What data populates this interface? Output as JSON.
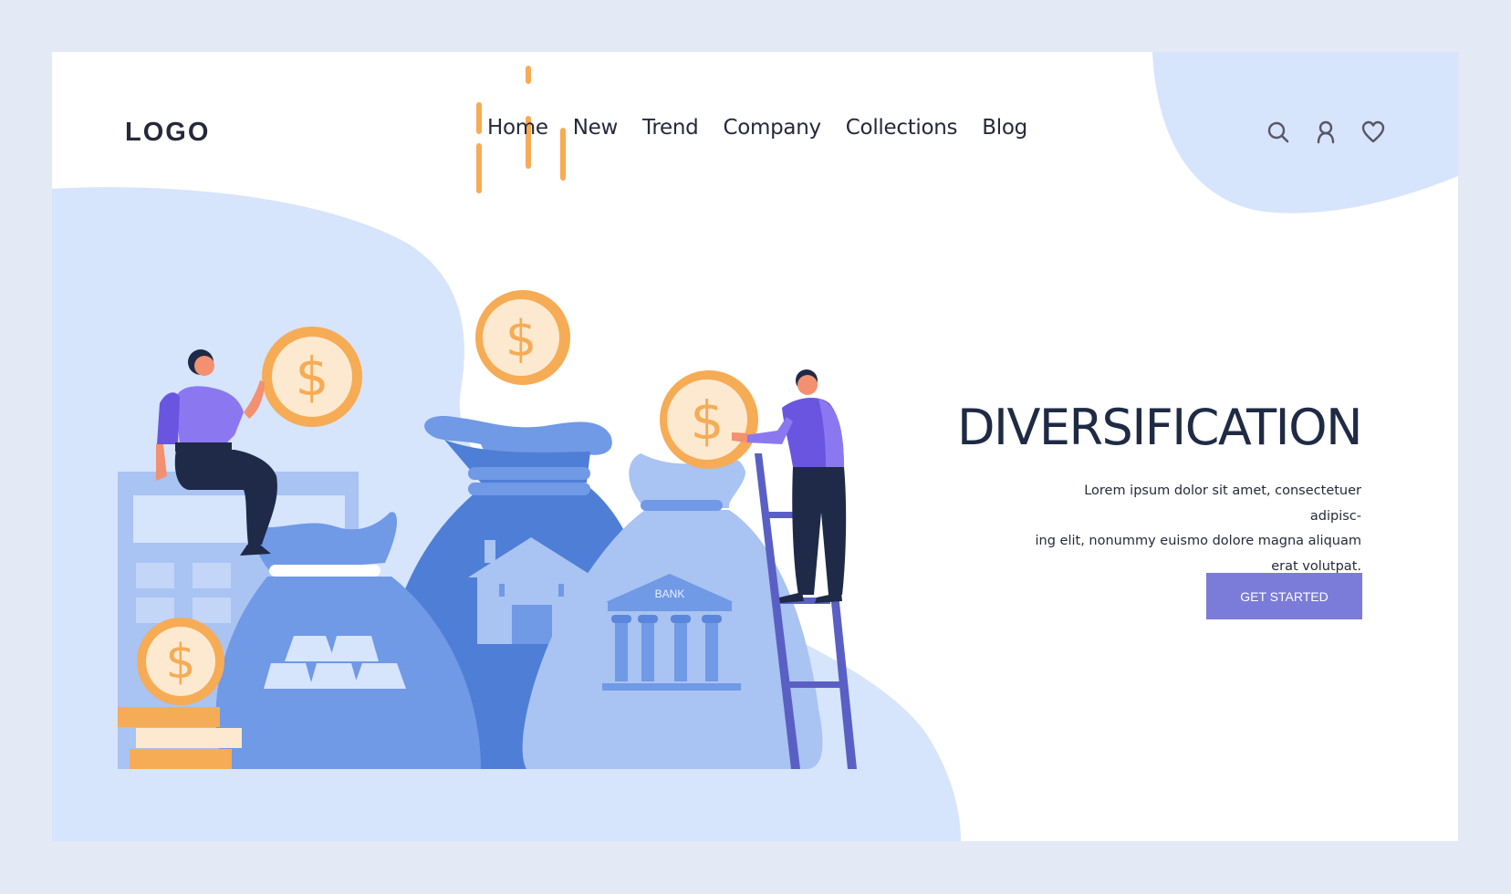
{
  "header": {
    "logo": "LOGO",
    "nav": [
      {
        "label": "Home"
      },
      {
        "label": "New"
      },
      {
        "label": "Trend"
      },
      {
        "label": "Company"
      },
      {
        "label": "Collections"
      },
      {
        "label": "Blog"
      }
    ],
    "icons": [
      "search-icon",
      "user-icon",
      "heart-icon"
    ]
  },
  "hero": {
    "title": "DIVERSIFICATION",
    "body_lines": [
      "Lorem ipsum dolor sit amet, consectetuer adipisc-",
      "ing elit, nonummy euismo dolore magna aliquam",
      "erat volutpat."
    ],
    "cta_label": "GET STARTED"
  },
  "illustration": {
    "bank_label": "BANK",
    "coin_symbol": "$"
  },
  "colors": {
    "page_bg": "#e3e9f5",
    "card_bg": "#ffffff",
    "blob": "#d6e4fc",
    "accent_button": "#7b7bd9",
    "heading": "#1f2a44",
    "coin": "#f6ab55",
    "coin_face": "#fde9cf",
    "bag_dark": "#4f7ed6",
    "bag_mid": "#7099e6",
    "bag_light": "#a9c3f2",
    "ladder": "#5a5fc4",
    "shirt": "#8b78f0",
    "pants": "#1e2a47"
  }
}
